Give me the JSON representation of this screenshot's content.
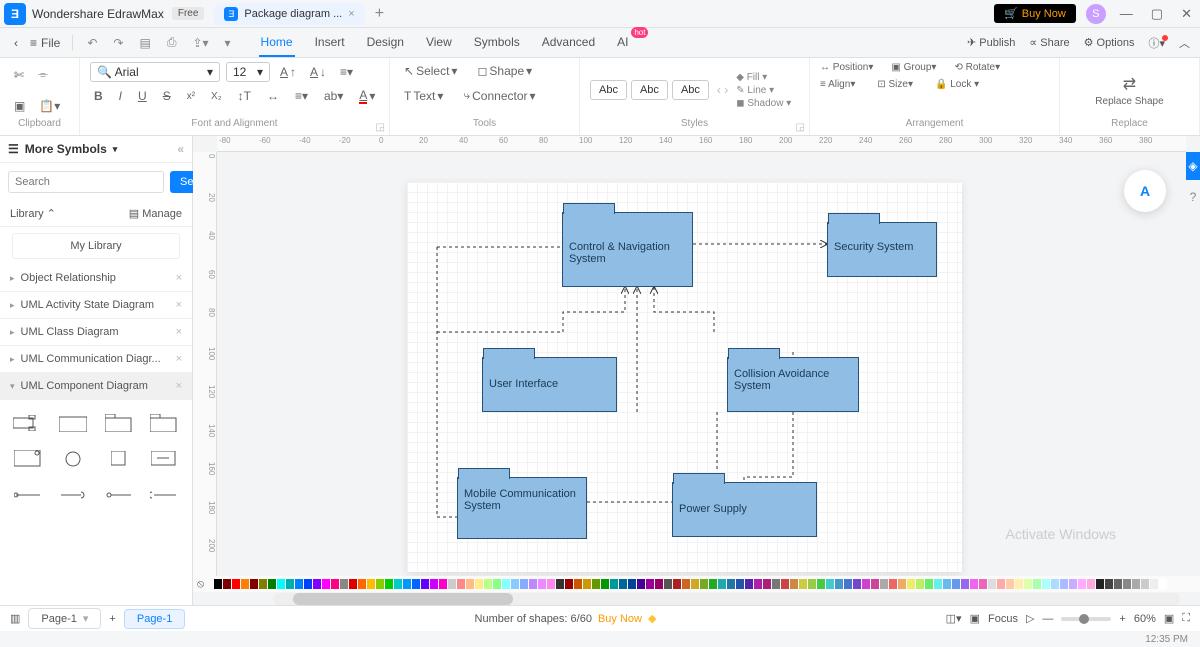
{
  "app": {
    "name": "Wondershare EdrawMax",
    "badge": "Free"
  },
  "tab": {
    "title": "Package diagram ..."
  },
  "topbar": {
    "buy_now": "Buy Now",
    "avatar_initial": "S"
  },
  "menubar": {
    "file": "File",
    "items": [
      "Home",
      "Insert",
      "Design",
      "View",
      "Symbols",
      "Advanced",
      "AI"
    ],
    "active": "Home",
    "hot_on": "AI",
    "right": {
      "publish": "Publish",
      "share": "Share",
      "options": "Options"
    }
  },
  "ribbon": {
    "clipboard": {
      "label": "Clipboard"
    },
    "font": {
      "label": "Font and Alignment",
      "font_name": "Arial",
      "font_size": "12"
    },
    "tools": {
      "label": "Tools",
      "select": "Select",
      "shape": "Shape",
      "text": "Text",
      "connector": "Connector"
    },
    "styles": {
      "label": "Styles",
      "chips": [
        "Abc",
        "Abc",
        "Abc"
      ],
      "fill": "Fill",
      "line": "Line",
      "shadow": "Shadow"
    },
    "arrangement": {
      "label": "Arrangement",
      "position": "Position",
      "group": "Group",
      "rotate": "Rotate",
      "align": "Align",
      "size": "Size",
      "lock": "Lock"
    },
    "replace": {
      "label": "Replace",
      "btn": "Replace Shape"
    }
  },
  "ruler_h": [
    "-80",
    "-60",
    "-40",
    "-20",
    "0",
    "20",
    "40",
    "60",
    "80",
    "100",
    "120",
    "140",
    "160",
    "180",
    "200",
    "220",
    "240",
    "260",
    "280",
    "300",
    "320",
    "340",
    "360",
    "380"
  ],
  "ruler_v": [
    "0",
    "20",
    "40",
    "60",
    "80",
    "100",
    "120",
    "140",
    "160",
    "180",
    "200"
  ],
  "left": {
    "more_symbols": "More Symbols",
    "search_placeholder": "Search",
    "search_btn": "Search",
    "library": "Library",
    "manage": "Manage",
    "my_library": "My Library",
    "cats": [
      "Object Relationship",
      "UML Activity State Diagram",
      "UML Class Diagram",
      "UML Communication Diagr...",
      "UML Component Diagram"
    ],
    "selected_cat": "UML Component Diagram"
  },
  "packages": {
    "control": "Control & Navigation System",
    "security": "Security System",
    "ui": "User Interface",
    "collision": "Collision Avoidance System",
    "mobile": "Mobile Communication System",
    "power": "Power Supply"
  },
  "activate": "Activate Windows",
  "status": {
    "page1": "Page-1",
    "page1b": "Page-1",
    "shapes": "Number of shapes: 6/60",
    "buy": "Buy Now",
    "focus": "Focus",
    "zoom": "60%",
    "time": "12:35 PM"
  },
  "colors": [
    "#000",
    "#7f0000",
    "#ff0000",
    "#ff7f00",
    "#800000",
    "#808000",
    "#008000",
    "#00ffff",
    "#00b0b0",
    "#0080ff",
    "#0040ff",
    "#7f00ff",
    "#ff00ff",
    "#ff0080",
    "#888",
    "#d00",
    "#f60",
    "#fb0",
    "#8c0",
    "#0c0",
    "#0cc",
    "#09f",
    "#06f",
    "#60f",
    "#c0f",
    "#f0c",
    "#ccc",
    "#f88",
    "#fb8",
    "#fe8",
    "#bf8",
    "#8f8",
    "#8ff",
    "#8cf",
    "#8af",
    "#b8f",
    "#e8f",
    "#f8e",
    "#333",
    "#900",
    "#c50",
    "#c90",
    "#690",
    "#090",
    "#099",
    "#069",
    "#049",
    "#409",
    "#909",
    "#906",
    "#555",
    "#a22",
    "#c62",
    "#ca2",
    "#7a2",
    "#2a2",
    "#2aa",
    "#27a",
    "#25a",
    "#52a",
    "#a2a",
    "#a27",
    "#777",
    "#c44",
    "#c84",
    "#cc4",
    "#9c4",
    "#4c4",
    "#4cc",
    "#49c",
    "#47c",
    "#74c",
    "#c4c",
    "#c49",
    "#aaa",
    "#e66",
    "#ea6",
    "#ee6",
    "#be6",
    "#6e6",
    "#6ee",
    "#6be",
    "#69e",
    "#96e",
    "#e6e",
    "#e6b",
    "#ddd",
    "#faa",
    "#fca",
    "#fea",
    "#dfa",
    "#afa",
    "#aff",
    "#adf",
    "#abf",
    "#caf",
    "#faf",
    "#fad",
    "#222",
    "#444",
    "#666",
    "#888",
    "#aaa",
    "#ccc",
    "#eee",
    "#fff"
  ]
}
